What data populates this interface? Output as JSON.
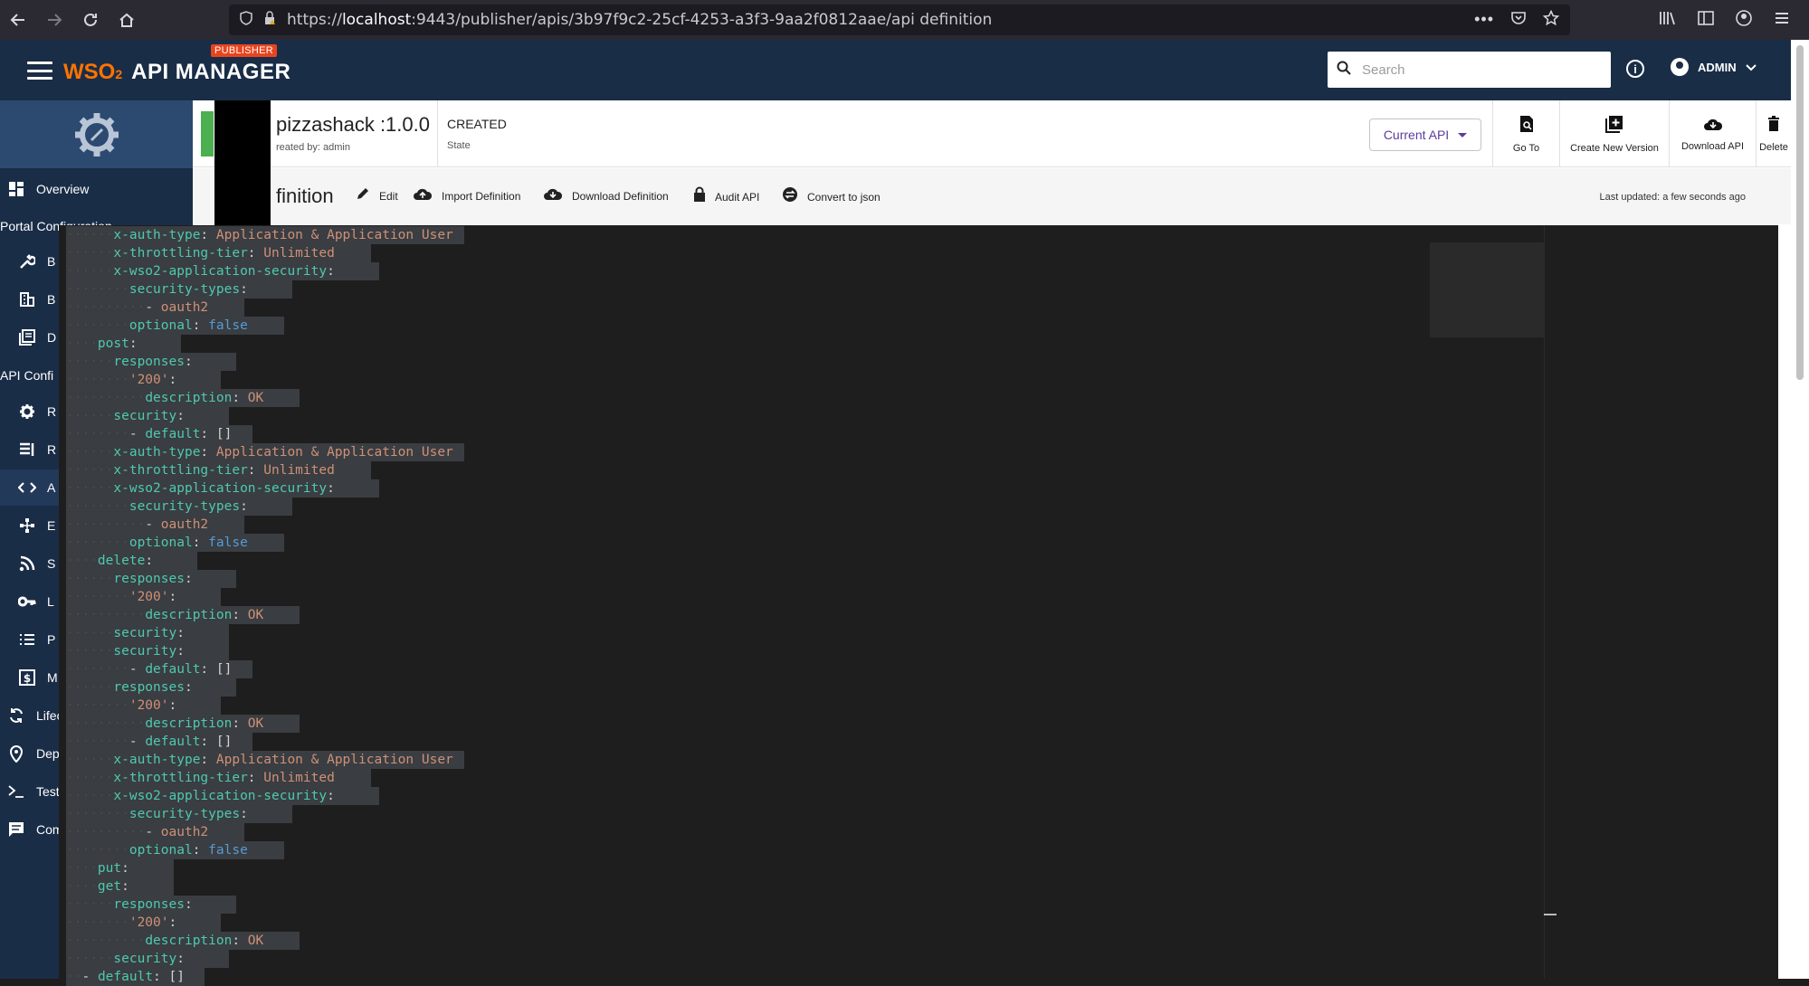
{
  "browser": {
    "url_prefix": "https://",
    "url_host": "localhost",
    "url_rest": ":9443/publisher/apis/3b97f9c2-25cf-4253-a3f3-9aa2f0812aae/api definition"
  },
  "header": {
    "logo_wso": "WSO",
    "logo_sub": "2",
    "product": "API MANAGER",
    "badge": "PUBLISHER",
    "search_placeholder": "Search",
    "user": "ADMIN"
  },
  "nav": {
    "overview": "Overview",
    "portal_config": "Portal Configuration",
    "api_config": "API Confi",
    "items": [
      {
        "label": "B"
      },
      {
        "label": "B"
      },
      {
        "label": "D"
      },
      {
        "label": "R"
      },
      {
        "label": "R"
      },
      {
        "label": "A"
      },
      {
        "label": "E"
      },
      {
        "label": "S"
      },
      {
        "label": "L"
      },
      {
        "label": "P"
      },
      {
        "label": "M"
      }
    ],
    "lifecycle": "Lifec",
    "deploy": "Dep",
    "test": "Test",
    "comments": "Com"
  },
  "api": {
    "name": "pizzashack :1.0.0",
    "created_by": "reated by: admin",
    "state": "CREATED",
    "state_label": "State",
    "version_select": "Current API"
  },
  "actions": {
    "go_to": "Go To",
    "create_new_version": "Create New Version",
    "download_api": "Download API",
    "delete": "Delete"
  },
  "toolbar": {
    "title": "finition",
    "edit": "Edit",
    "import": "Import Definition",
    "download": "Download Definition",
    "audit": "Audit API",
    "convert": "Convert to json",
    "last_updated": "Last updated: a few seconds ago"
  },
  "editor_lines": [
    {
      "indent": 2,
      "key": "x-auth-type",
      "val": "Application & Application User",
      "vt": "s"
    },
    {
      "indent": 2,
      "key": "x-throttling-tier",
      "val": "Unlimited",
      "vt": "s"
    },
    {
      "indent": 2,
      "key": "x-wso2-application-security",
      "val": "",
      "vt": "p"
    },
    {
      "indent": 3,
      "key": "security-types",
      "val": "",
      "vt": "p"
    },
    {
      "indent": 4,
      "dash": true,
      "key": "",
      "val": "oauth2",
      "vt": "s"
    },
    {
      "indent": 3,
      "key": "optional",
      "val": "false",
      "vt": "b"
    },
    {
      "indent": 1,
      "key": "post",
      "val": "",
      "vt": "p"
    },
    {
      "indent": 2,
      "key": "responses",
      "val": "",
      "vt": "p"
    },
    {
      "indent": 3,
      "key": "'200'",
      "val": "",
      "vt": "p",
      "keyclass": "s"
    },
    {
      "indent": 4,
      "key": "description",
      "val": "OK",
      "vt": "s"
    },
    {
      "indent": 2,
      "key": "security",
      "val": "",
      "vt": "p"
    },
    {
      "indent": 3,
      "dash": true,
      "key": "default",
      "val": "[]",
      "vt": "p"
    },
    {
      "indent": 2,
      "key": "x-auth-type",
      "val": "Application & Application User",
      "vt": "s"
    },
    {
      "indent": 2,
      "key": "x-throttling-tier",
      "val": "Unlimited",
      "vt": "s"
    },
    {
      "indent": 2,
      "key": "x-wso2-application-security",
      "val": "",
      "vt": "p"
    },
    {
      "indent": 3,
      "key": "security-types",
      "val": "",
      "vt": "p"
    },
    {
      "indent": 4,
      "dash": true,
      "key": "",
      "val": "oauth2",
      "vt": "s"
    },
    {
      "indent": 3,
      "key": "optional",
      "val": "false",
      "vt": "b"
    },
    {
      "indent": 1,
      "key": "delete",
      "val": "",
      "vt": "p"
    },
    {
      "indent": 2,
      "key": "responses",
      "val": "",
      "vt": "p"
    },
    {
      "indent": 3,
      "key": "'200'",
      "val": "",
      "vt": "p",
      "keyclass": "s"
    },
    {
      "indent": 4,
      "key": "description",
      "val": "OK",
      "vt": "s"
    },
    {
      "indent": 2,
      "key": "security",
      "val": "",
      "vt": "p"
    },
    {
      "indent": 2,
      "key": "security",
      "val": "",
      "vt": "p"
    },
    {
      "indent": 3,
      "dash": true,
      "key": "default",
      "val": "[]",
      "vt": "p"
    },
    {
      "indent": 2,
      "key": "responses",
      "val": "",
      "vt": "p"
    },
    {
      "indent": 3,
      "key": "'200'",
      "val": "",
      "vt": "p",
      "keyclass": "s"
    },
    {
      "indent": 4,
      "key": "description",
      "val": "OK",
      "vt": "s"
    },
    {
      "indent": 3,
      "dash": true,
      "key": "default",
      "val": "[]",
      "vt": "p"
    },
    {
      "indent": 2,
      "key": "x-auth-type",
      "val": "Application & Application User",
      "vt": "s"
    },
    {
      "indent": 2,
      "key": "x-throttling-tier",
      "val": "Unlimited",
      "vt": "s"
    },
    {
      "indent": 2,
      "key": "x-wso2-application-security",
      "val": "",
      "vt": "p"
    },
    {
      "indent": 3,
      "key": "security-types",
      "val": "",
      "vt": "p"
    },
    {
      "indent": 4,
      "dash": true,
      "key": "",
      "val": "oauth2",
      "vt": "s"
    },
    {
      "indent": 3,
      "key": "optional",
      "val": "false",
      "vt": "b"
    },
    {
      "indent": 1,
      "key": "put",
      "val": "",
      "vt": "p"
    },
    {
      "indent": 1,
      "key": "get",
      "val": "",
      "vt": "p"
    },
    {
      "indent": 2,
      "key": "responses",
      "val": "",
      "vt": "p"
    },
    {
      "indent": 3,
      "key": "'200'",
      "val": "",
      "vt": "p",
      "keyclass": "s"
    },
    {
      "indent": 4,
      "key": "description",
      "val": "OK",
      "vt": "s"
    },
    {
      "indent": 2,
      "key": "security",
      "val": "",
      "vt": "p"
    },
    {
      "indent": 0,
      "dash": true,
      "key": "default",
      "val": "[]",
      "vt": "p"
    }
  ]
}
